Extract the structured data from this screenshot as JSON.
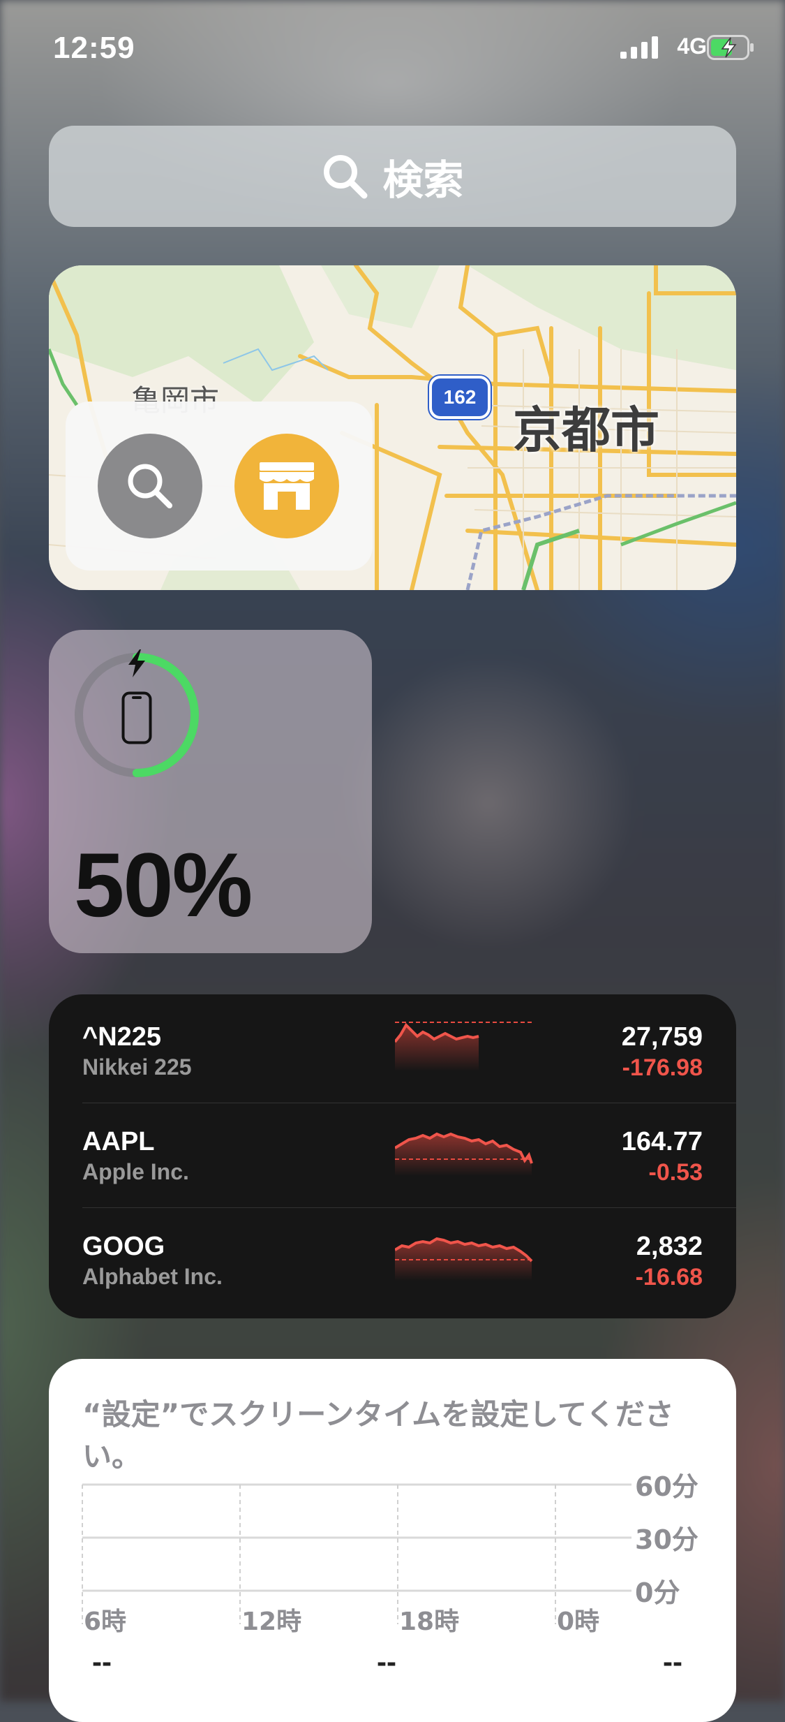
{
  "status_bar": {
    "time": "12:59",
    "network": "4G"
  },
  "search": {
    "label": "検索"
  },
  "map": {
    "city_label": "京都市",
    "town_label": "亀岡市",
    "route_number": "162"
  },
  "battery": {
    "percent": "50%",
    "level": 0.5
  },
  "stocks": [
    {
      "symbol": "^N225",
      "name": "Nikkei 225",
      "price": "27,759",
      "change": "-176.98"
    },
    {
      "symbol": "AAPL",
      "name": "Apple Inc.",
      "price": "164.77",
      "change": "-0.53"
    },
    {
      "symbol": "GOOG",
      "name": "Alphabet Inc.",
      "price": "2,832",
      "change": "-16.68"
    }
  ],
  "screen_time": {
    "message": "“設定”でスクリーンタイムを設定してください。",
    "y_labels": [
      "60分",
      "30分",
      "0分"
    ],
    "x_labels": [
      "6時",
      "12時",
      "18時",
      "0時"
    ],
    "summary": [
      "--",
      "--",
      "--"
    ]
  },
  "colors": {
    "accent_green": "#4cd964",
    "stock_red": "#f0554b",
    "map_orange": "#f1b43a"
  }
}
